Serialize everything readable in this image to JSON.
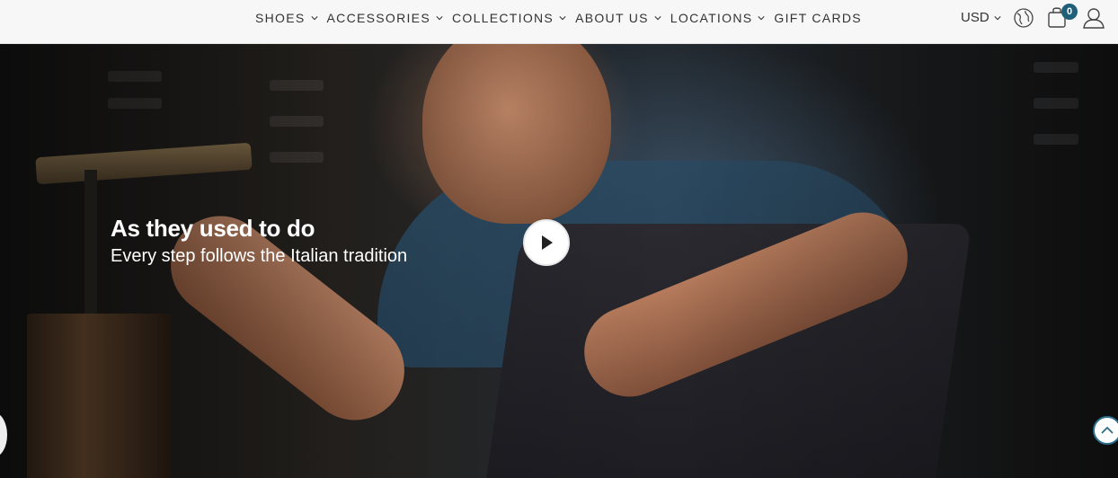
{
  "nav": {
    "items": [
      {
        "label": "SHOES",
        "has_dropdown": true
      },
      {
        "label": "ACCESSORIES",
        "has_dropdown": true
      },
      {
        "label": "COLLECTIONS",
        "has_dropdown": true
      },
      {
        "label": "ABOUT US",
        "has_dropdown": true
      },
      {
        "label": "LOCATIONS",
        "has_dropdown": true
      },
      {
        "label": "GIFT CARDS",
        "has_dropdown": false
      }
    ]
  },
  "tools": {
    "currency": "USD",
    "cart_count": "0",
    "icons": [
      "chevron-down-icon",
      "globe-icon",
      "shopping-bag-icon",
      "user-icon"
    ]
  },
  "hero": {
    "title": "As they used to do",
    "subtitle": "Every step follows the Italian tradition",
    "icons": [
      "play-icon",
      "chevron-up-icon"
    ]
  },
  "colors": {
    "header_bg": "#f7f7f7",
    "badge": "#1f5f7a",
    "accent": "#2d6d8a",
    "text": "#333333"
  }
}
